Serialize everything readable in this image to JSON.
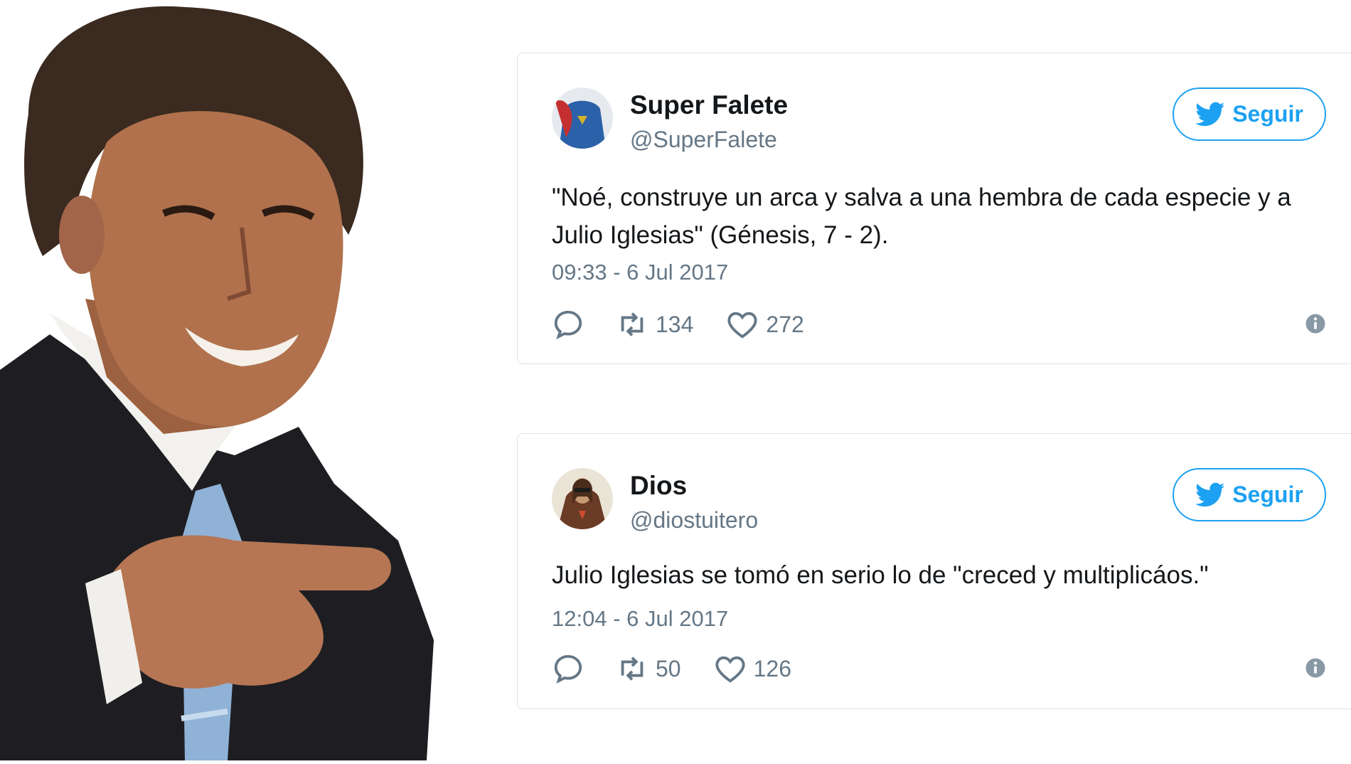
{
  "tweets": [
    {
      "display_name": "Super Falete",
      "handle": "@SuperFalete",
      "follow_label": "Seguir",
      "text": "\"Noé, construye un arca y salva a una hembra de cada especie y a Julio Iglesias\" (Génesis, 7 - 2).",
      "timestamp": "09:33 - 6 Jul 2017",
      "retweets": "134",
      "likes": "272"
    },
    {
      "display_name": "Dios",
      "handle": "@diostuitero",
      "follow_label": "Seguir",
      "text": "Julio Iglesias se tomó en serio lo de \"creced y multiplicáos.\"",
      "timestamp": "12:04 - 6 Jul 2017",
      "retweets": "50",
      "likes": "126"
    }
  ],
  "colors": {
    "accent": "#1da1f2",
    "text": "#14171a",
    "secondary": "#657786",
    "border": "#dfe3e7"
  },
  "icons": [
    "twitter-bird-icon",
    "reply-icon",
    "retweet-icon",
    "heart-icon",
    "info-icon"
  ]
}
